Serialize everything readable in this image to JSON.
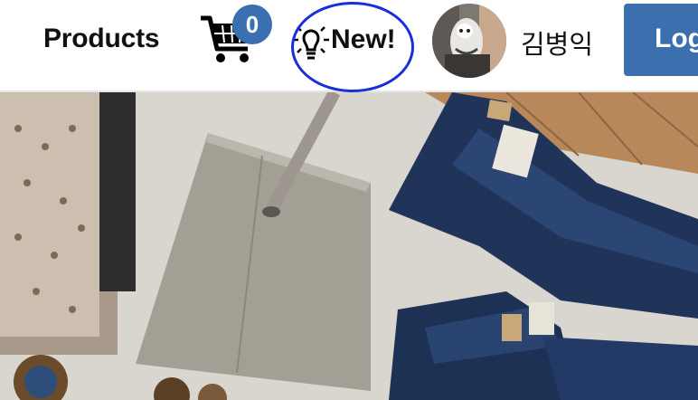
{
  "nav": {
    "products_label": "Products",
    "cart_count": "0",
    "new_label": "New!",
    "user_name": "김병익",
    "login_label": "Log"
  },
  "icons": {
    "cart": "cart-icon",
    "new": "lightbulb-icon",
    "avatar": "avatar-image"
  },
  "colors": {
    "accent": "#3c6fae",
    "highlight_circle": "#1a2fdc"
  },
  "hero": {
    "image": "clothing-store-floor-with-jeans-and-shirts"
  }
}
